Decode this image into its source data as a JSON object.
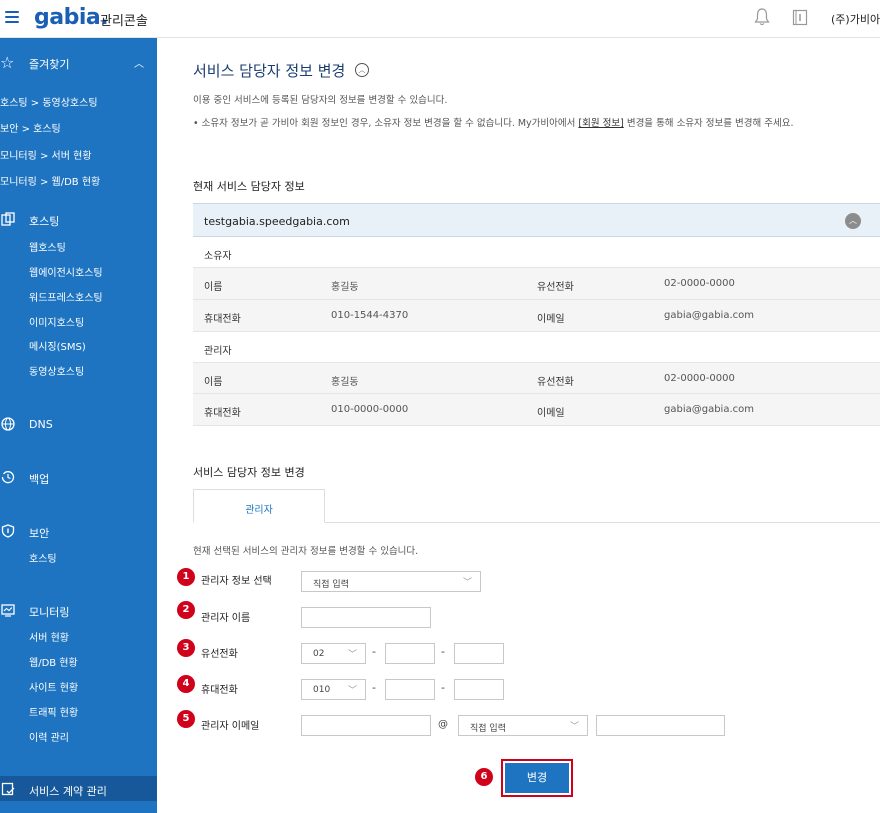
{
  "header": {
    "logo": "gabia.",
    "console_title": "관리콘솔",
    "company": "(주)가비아"
  },
  "sidebar": {
    "favorites_label": "즐겨찾기",
    "favorites": [
      "호스팅 > 동영상호스팅",
      "보안 > 호스팅",
      "모니터링 > 서버 현황",
      "모니터링 > 웹/DB 현황"
    ],
    "hosting": {
      "label": "호스팅",
      "items": [
        "웹호스팅",
        "웹에이전시호스팅",
        "워드프레스호스팅",
        "이미지호스팅",
        "메시징(SMS)",
        "동영상호스팅"
      ]
    },
    "dns": {
      "label": "DNS"
    },
    "backup": {
      "label": "백업"
    },
    "security": {
      "label": "보안",
      "items": [
        "호스팅"
      ]
    },
    "monitoring": {
      "label": "모니터링",
      "items": [
        "서버 현황",
        "웹/DB 현황",
        "사이트 현황",
        "트래픽 현황",
        "이력 관리"
      ]
    },
    "contract": {
      "label": "서비스 계약 관리"
    }
  },
  "main": {
    "title": "서비스 담당자 정보 변경",
    "desc1": "이용 중인 서비스에 등록된 담당자의 정보를 변경할 수 있습니다.",
    "desc2_before": "•  소유자 정보가 곧 가비아 회원 정보인 경우, 소유자 정보 변경을 할 수 없습니다. My가비아에서 ",
    "desc2_link": "[회원 정보]",
    "desc2_after": " 변경을 통해 소유자 정보를 변경해 주세요.",
    "current_heading": "현재 서비스 담당자 정보",
    "domain": "testgabia.speedgabia.com",
    "owner": {
      "group": "소유자",
      "name_label": "이름",
      "name": "홍길동",
      "phone_label": "유선전화",
      "phone": "02-0000-0000",
      "mobile_label": "휴대전화",
      "mobile": "010-1544-4370",
      "email_label": "이메일",
      "email": "gabia@gabia.com"
    },
    "admin": {
      "group": "관리자",
      "name_label": "이름",
      "name": "홍길동",
      "phone_label": "유선전화",
      "phone": "02-0000-0000",
      "mobile_label": "휴대전화",
      "mobile": "010-0000-0000",
      "email_label": "이메일",
      "email": "gabia@gabia.com"
    },
    "change_heading": "서비스 담당자 정보 변경",
    "tab_label": "관리자",
    "form_desc": "현재 선택된 서비스의 관리자 정보를 변경할 수 있습니다.",
    "form": {
      "steps": [
        "1",
        "2",
        "3",
        "4",
        "5",
        "6"
      ],
      "select_label": "관리자 정보 선택",
      "select_value": "직접 입력",
      "name_label": "관리자 이름",
      "phone_label": "유선전화",
      "phone_prefix": "02",
      "mobile_label": "휴대전화",
      "mobile_prefix": "010",
      "email_label": "관리자 이메일",
      "email_domain_select": "직접 입력",
      "dash": "-",
      "at": "@",
      "submit_label": "변경"
    }
  }
}
